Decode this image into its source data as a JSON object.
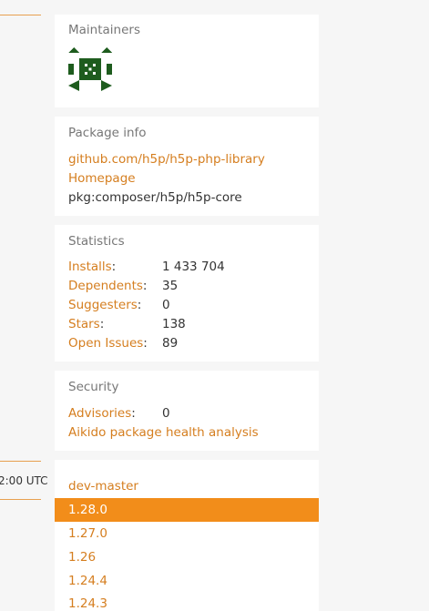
{
  "left": {
    "timestamp": "2:00 UTC"
  },
  "maintainers": {
    "heading": "Maintainers"
  },
  "package_info": {
    "heading": "Package info",
    "repo_link": "github.com/h5p/h5p-php-library",
    "homepage_link": "Homepage",
    "pkg_id": "pkg:composer/h5p/h5p-core"
  },
  "statistics": {
    "heading": "Statistics",
    "rows": [
      {
        "label": "Installs",
        "value": "1 433 704"
      },
      {
        "label": "Dependents",
        "value": "35"
      },
      {
        "label": "Suggesters",
        "value": "0"
      },
      {
        "label": "Stars",
        "value": "138"
      },
      {
        "label": "Open Issues",
        "value": "89"
      }
    ]
  },
  "security": {
    "heading": "Security",
    "advisories_label": "Advisories",
    "advisories_value": "0",
    "aikido_link": "Aikido package health analysis"
  },
  "versions": [
    "dev-master",
    "1.28.0",
    "1.27.0",
    "1.26",
    "1.24.4",
    "1.24.3"
  ],
  "colors": {
    "accent": "#f28d1a",
    "link": "#d57e1f",
    "avatar": "#1e5c1e"
  }
}
